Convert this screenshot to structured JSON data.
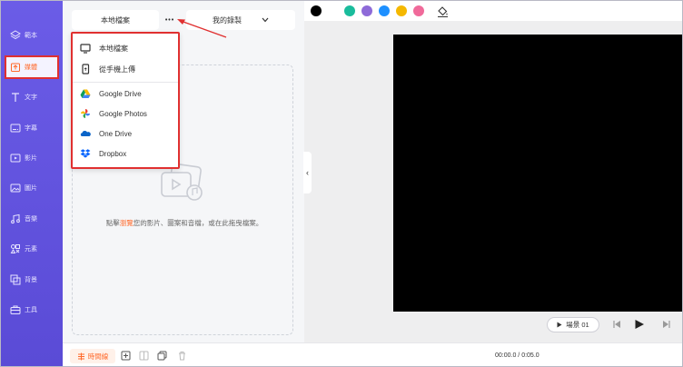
{
  "sidebar": {
    "items": [
      {
        "label": "範本",
        "icon": "layers-icon"
      },
      {
        "label": "媒體",
        "icon": "media-upload-icon"
      },
      {
        "label": "文字",
        "icon": "text-icon"
      },
      {
        "label": "字幕",
        "icon": "subtitle-icon"
      },
      {
        "label": "影片",
        "icon": "video-icon"
      },
      {
        "label": "圖片",
        "icon": "image-icon"
      },
      {
        "label": "音樂",
        "icon": "music-icon"
      },
      {
        "label": "元素",
        "icon": "elements-icon"
      },
      {
        "label": "背景",
        "icon": "background-icon"
      },
      {
        "label": "工具",
        "icon": "toolbox-icon"
      }
    ],
    "active_index": 1,
    "colors": {
      "bg": "#6b5ce7",
      "active_text": "#ff6a2b",
      "highlight_border": "#e03030"
    }
  },
  "panel": {
    "local_files_tab": "本地檔案",
    "more_button": "•••",
    "my_recordings": "我的錄製",
    "drop_text_before": "點擊",
    "drop_text_link": "瀏覽",
    "drop_text_after": "您的影片、圖案和音檔，或在此拖曳檔案。"
  },
  "menu": {
    "items": [
      {
        "label": "本地檔案",
        "icon": "monitor-icon"
      },
      {
        "label": "從手機上傳",
        "icon": "phone-icon"
      },
      {
        "label": "Google Drive",
        "icon": "google-drive-icon"
      },
      {
        "label": "Google Photos",
        "icon": "google-photos-icon"
      },
      {
        "label": "One Drive",
        "icon": "onedrive-icon"
      },
      {
        "label": "Dropbox",
        "icon": "dropbox-icon"
      }
    ]
  },
  "colorbar": {
    "swatches": [
      "#000000",
      "#1abc9c",
      "#8e6ad8",
      "#1e90ff",
      "#f5b800",
      "#f06a9a"
    ],
    "fill_icon": "paint-bucket-icon"
  },
  "player": {
    "scene_label": "場景 01",
    "time": "00:00.0 / 0:05.0"
  },
  "bottom": {
    "timeline_label": "時間線"
  }
}
